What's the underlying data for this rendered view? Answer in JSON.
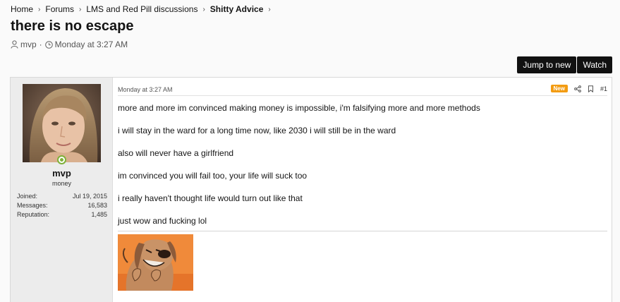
{
  "breadcrumb": {
    "items": [
      "Home",
      "Forums",
      "LMS and Red Pill discussions",
      "Shitty Advice"
    ]
  },
  "thread": {
    "title": "there is no escape",
    "author": "mvp",
    "date": "Monday at 3:27 AM",
    "separator": "·"
  },
  "buttons": {
    "jump_to_new": "Jump to new",
    "watch": "Watch"
  },
  "post": {
    "date": "Monday at 3:27 AM",
    "badge": "New",
    "number": "#1",
    "paragraphs": [
      "more and more im convinced making money is impossible, i'm falsifying more and more methods",
      "i will stay in the ward for a long time now, like 2030 i will still be in the ward",
      "also will never have a girlfriend",
      "im convinced you will fail too, your life will suck too",
      "i really haven't thought life would turn out like that",
      "just wow and fucking lol"
    ]
  },
  "user": {
    "name": "mvp",
    "title": "money",
    "stats": [
      {
        "label": "Joined:",
        "value": "Jul 19, 2015"
      },
      {
        "label": "Messages:",
        "value": "16,583"
      },
      {
        "label": "Reputation:",
        "value": "1,485"
      }
    ]
  },
  "colors": {
    "badge_new": "#f39c12",
    "online": "#7fb13a",
    "button_bg": "#111111"
  },
  "icons": {
    "author": "user-icon",
    "date": "clock-icon",
    "share": "share-icon",
    "bookmark": "bookmark-icon"
  }
}
